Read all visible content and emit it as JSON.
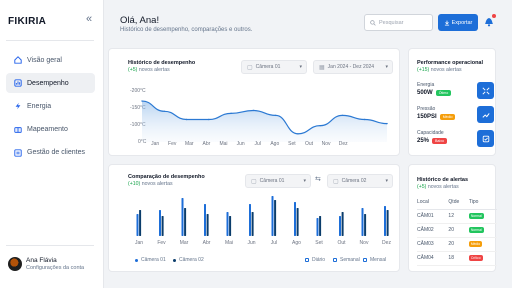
{
  "sidebar": {
    "brand": "FIKIRIA",
    "items": [
      {
        "label": "Visão geral"
      },
      {
        "label": "Desempenho"
      },
      {
        "label": "Energia"
      },
      {
        "label": "Mapeamento"
      },
      {
        "label": "Gestão de clientes"
      }
    ],
    "user": {
      "name": "Ana Flávia",
      "subtitle": "Configurações da conta"
    }
  },
  "header": {
    "greeting": "Olá, Ana!",
    "subtitle": "Histórico de desempenho, comparações e outros.",
    "search_placeholder": "Pesquisar",
    "export_label": "Exportar"
  },
  "history_card": {
    "title": "Histórico de desempenho",
    "sub_count": "(+5)",
    "sub_text": "novos alertas",
    "camera_select": "Câmera 01",
    "date_select": "Jan 2024 - Dez 2024",
    "y_ticks": [
      "-200°C",
      "-150°C",
      "-100°C",
      "0°C"
    ]
  },
  "compare_card": {
    "title": "Comparação de desempenho",
    "sub_count": "(+10)",
    "sub_text": "novos alertas",
    "camera_a": "Câmera 01",
    "camera_b": "Câmera 02",
    "legend": [
      "Câmera 01",
      "Câmera 02"
    ],
    "periods": [
      "Diário",
      "Semanal",
      "Mensal"
    ]
  },
  "perf_card": {
    "title": "Performance operacional",
    "sub_count": "(+15)",
    "sub_text": "novos alertas",
    "rows": [
      {
        "label": "Energia",
        "value": "500W",
        "badge": "Ótimo",
        "badge_color": "#22c55e"
      },
      {
        "label": "Pressão",
        "value": "150PSI",
        "badge": "Médio",
        "badge_color": "#f59e0b"
      },
      {
        "label": "Capacidade",
        "value": "25%",
        "badge": "Baixo",
        "badge_color": "#ef4444"
      }
    ]
  },
  "alerts_card": {
    "title": "Histórico de alertas",
    "sub_count": "(+5)",
    "sub_text": "novos alertas",
    "headers": [
      "Local",
      "Qtde",
      "Tipo"
    ],
    "rows": [
      {
        "local": "CÂM01",
        "qty": "12",
        "type": "Normal",
        "color": "#22c55e"
      },
      {
        "local": "CÂM02",
        "qty": "20",
        "type": "Normal",
        "color": "#22c55e"
      },
      {
        "local": "CÂM03",
        "qty": "20",
        "type": "Médio",
        "color": "#f59e0b"
      },
      {
        "local": "CÂM04",
        "qty": "18",
        "type": "Crítico",
        "color": "#ef4444"
      }
    ]
  },
  "colors": {
    "accent": "#1d6ed8",
    "dark_bar": "#0b3d6b",
    "green": "#16a34a"
  },
  "chart_data": [
    {
      "type": "area",
      "title": "Histórico de desempenho",
      "categories": [
        "Jan",
        "Fev",
        "Mar",
        "Abr",
        "Mai",
        "Jun",
        "Jul",
        "Ago",
        "Set",
        "Out",
        "Nov",
        "Dez"
      ],
      "y_ticks": [
        "-200°C",
        "-150°C",
        "-100°C",
        "0°C"
      ],
      "values": [
        -105,
        -130,
        -150,
        -150,
        -135,
        -128,
        -140,
        -185,
        -165,
        -140,
        -150,
        -160
      ]
    },
    {
      "type": "bar",
      "title": "Comparação de desempenho",
      "categories": [
        "Jan",
        "Fev",
        "Mar",
        "Abr",
        "Mai",
        "Jun",
        "Jul",
        "Ago",
        "Set",
        "Out",
        "Nov",
        "Dez"
      ],
      "series": [
        {
          "name": "Câmera 01",
          "values": [
            0.55,
            0.65,
            0.95,
            0.8,
            0.6,
            0.8,
            1.0,
            0.85,
            0.45,
            0.5,
            0.7,
            0.75
          ]
        },
        {
          "name": "Câmera 02",
          "values": [
            0.65,
            0.5,
            0.7,
            0.55,
            0.5,
            0.6,
            0.9,
            0.7,
            0.5,
            0.6,
            0.55,
            0.65
          ]
        }
      ]
    }
  ]
}
